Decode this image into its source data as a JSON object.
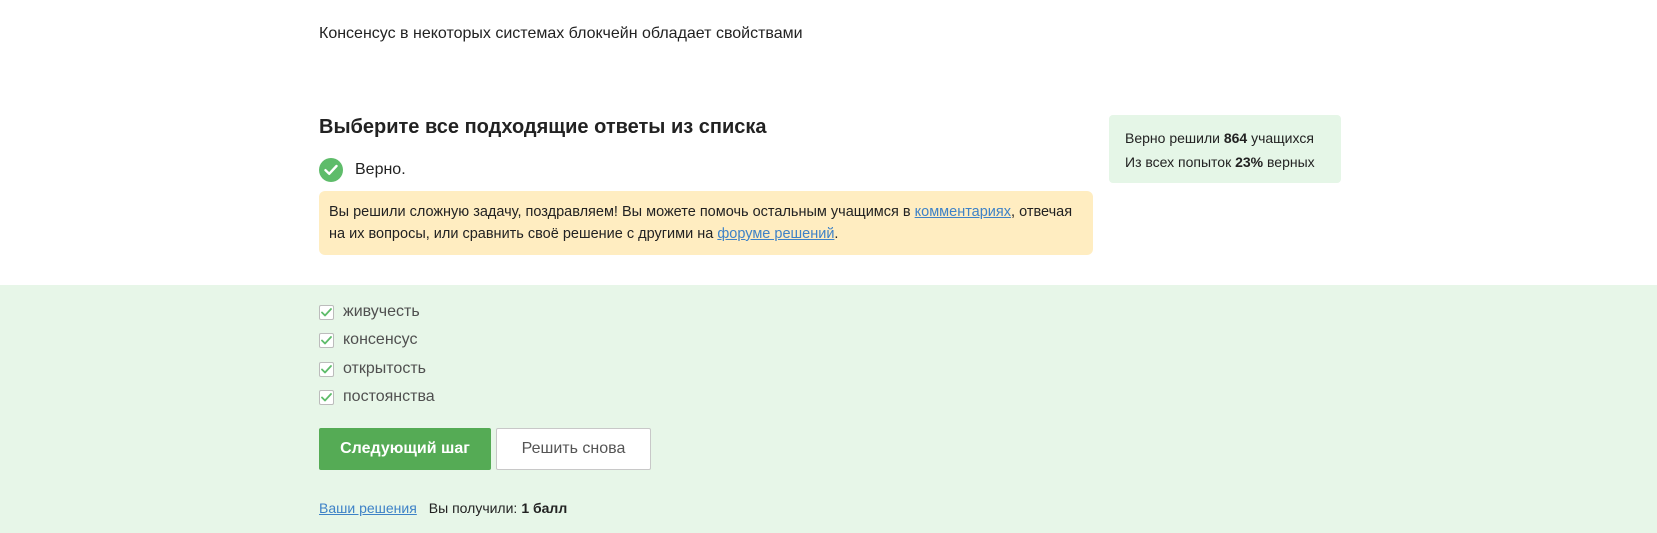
{
  "question": {
    "text": "Консенсус в некоторых системах блокчейн обладает свойствами"
  },
  "task": {
    "heading": "Выберите все подходящие ответы из списка",
    "status_icon": "check-circle-icon",
    "status_text": "Верно."
  },
  "feedback": {
    "text_1": "Вы решили сложную задачу, поздравляем! Вы можете помочь остальным учащимся в ",
    "link_comments": "комментариях",
    "text_2": ", отвечая на их вопросы, или сравнить своё решение с другими на ",
    "link_forum": "форуме решений",
    "text_3": "."
  },
  "stats": {
    "solved_prefix": "Верно решили ",
    "solved_count": "864",
    "solved_suffix": " учащихся",
    "attempts_prefix": "Из всех попыток ",
    "attempts_percent": "23%",
    "attempts_suffix": " верных"
  },
  "options": [
    {
      "label": "живучесть",
      "checked": true
    },
    {
      "label": "консенсус",
      "checked": true
    },
    {
      "label": "открытость",
      "checked": true
    },
    {
      "label": "постоянства",
      "checked": true
    }
  ],
  "buttons": {
    "next": "Следующий шаг",
    "retry": "Решить снова"
  },
  "footer": {
    "your_solutions": "Ваши решения",
    "score_label": "Вы получили:",
    "score_value": "1 балл"
  },
  "colors": {
    "accent_green": "#55ab55",
    "check_green": "#5ebc6a",
    "answers_bg": "#e7f6e8",
    "stats_bg": "#e5f6e7",
    "feedback_bg": "#ffedc1",
    "link_blue": "#3e82c7"
  }
}
